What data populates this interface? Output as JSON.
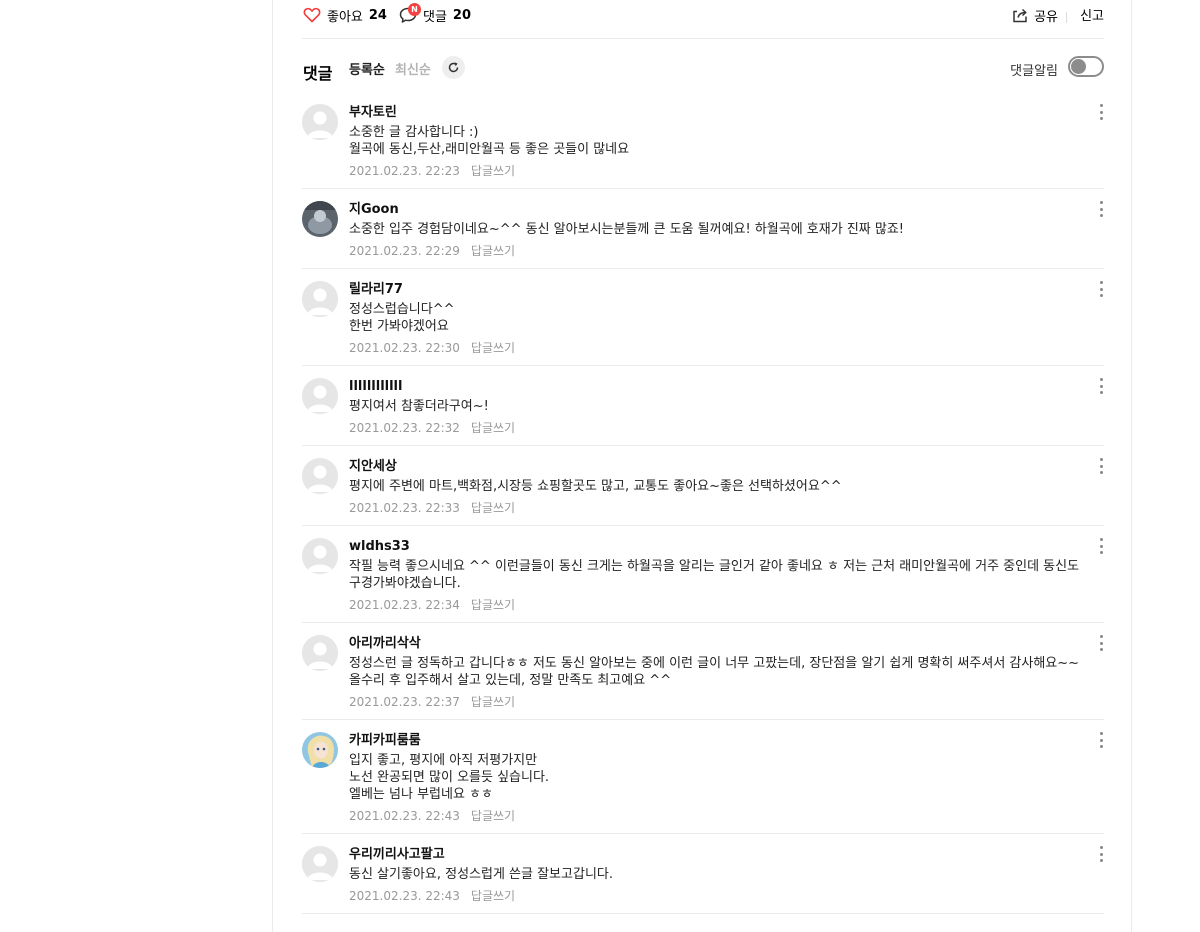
{
  "actions": {
    "like_label": "좋아요",
    "like_count": "24",
    "comment_label": "댓글",
    "comment_count": "20",
    "comment_badge": "N",
    "share_label": "공유",
    "report_label": "신고"
  },
  "comments_header": {
    "title": "댓글",
    "sort_registered": "등록순",
    "sort_latest": "최신순",
    "notify_label": "댓글알림",
    "notify_on": false
  },
  "reply_label": "답글쓰기",
  "comments": [
    {
      "nick": "부자토린",
      "text": "소중한 글 감사합니다 :)\n월곡에 동신,두산,래미안월곡 등 좋은 곳들이 많네요",
      "date": "2021.02.23. 22:23",
      "avatar": "default"
    },
    {
      "nick": "지Goon",
      "text": "소중한 입주 경험담이네요~^^ 동신 알아보시는분들께 큰 도움 될꺼예요! 하월곡에 호재가 진짜 많죠!",
      "date": "2021.02.23. 22:29",
      "avatar": "photo-dark"
    },
    {
      "nick": "릴라리77",
      "text": "정성스럽습니다^^\n한번 가봐야겠어요",
      "date": "2021.02.23. 22:30",
      "avatar": "default"
    },
    {
      "nick": "llllllllllll",
      "text": "평지여서 참좋더라구여~!",
      "date": "2021.02.23. 22:32",
      "avatar": "default"
    },
    {
      "nick": "지안세상",
      "text": "평지에 주변에 마트,백화점,시장등 쇼핑할곳도 많고, 교통도 좋아요~좋은 선택하셨어요^^",
      "date": "2021.02.23. 22:33",
      "avatar": "default"
    },
    {
      "nick": "wldhs33",
      "text": "작필 능력 좋으시네요 ^^ 이런글들이 동신 크게는 하월곡을 알리는 글인거 같아 좋네요 ㅎ 저는 근처 래미안월곡에 거주 중인데 동신도 구경가봐야겠습니다.",
      "date": "2021.02.23. 22:34",
      "avatar": "default"
    },
    {
      "nick": "아리까리삭삭",
      "text": "정성스런 글 정독하고 갑니다ㅎㅎ 저도 동신 알아보는 중에 이런 글이 너무 고팠는데, 장단점을 알기 쉽게 명확히 써주셔서 감사해요~~ 올수리 후 입주해서 살고 있는데, 정말 만족도 최고예요 ^^",
      "date": "2021.02.23. 22:37",
      "avatar": "default"
    },
    {
      "nick": "카피카피룸룸",
      "text": "입지 좋고, 평지에 아직 저평가지만\n노선 완공되면 많이 오를듯 싶습니다.\n엘베는 넘나 부럽네요 ㅎㅎ",
      "date": "2021.02.23. 22:43",
      "avatar": "photo-character"
    },
    {
      "nick": "우리끼리사고팔고",
      "text": "동신 살기좋아요, 정성스럽게 쓴글 잘보고갑니다.",
      "date": "2021.02.23. 22:43",
      "avatar": "default"
    }
  ]
}
